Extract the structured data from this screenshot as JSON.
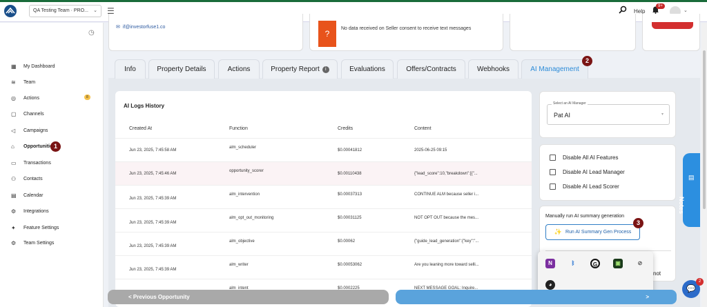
{
  "header": {
    "team_select": "QA Testing Team · PRO...",
    "help": "Help",
    "notifications_badge": "9+"
  },
  "sidebar": {
    "items": [
      {
        "label": "My Dashboard",
        "icon": "dashboard-icon"
      },
      {
        "label": "Team",
        "icon": "layers-icon"
      },
      {
        "label": "Actions",
        "icon": "check-circle-icon",
        "badge": "8"
      },
      {
        "label": "Channels",
        "icon": "chat-icon"
      },
      {
        "label": "Campaigns",
        "icon": "megaphone-icon"
      },
      {
        "label": "Opportunities",
        "icon": "home-icon"
      },
      {
        "label": "Transactions",
        "icon": "money-icon"
      },
      {
        "label": "Contacts",
        "icon": "people-icon"
      },
      {
        "label": "Calendar",
        "icon": "calendar-icon"
      },
      {
        "label": "Integrations",
        "icon": "plug-icon"
      },
      {
        "label": "Feature Settings",
        "icon": "feature-icon"
      },
      {
        "label": "Team Settings",
        "icon": "gear-icon"
      }
    ]
  },
  "markers": {
    "one": "1",
    "two": "2",
    "three": "3"
  },
  "top_cards": {
    "email": "if@investorfuse1.co",
    "consent_message": "No data received on Seller consent to receive text messages"
  },
  "tabs": [
    {
      "label": "Info"
    },
    {
      "label": "Property Details"
    },
    {
      "label": "Actions"
    },
    {
      "label": "Property Report"
    },
    {
      "label": "Evaluations"
    },
    {
      "label": "Offers/Contracts"
    },
    {
      "label": "Webhooks"
    },
    {
      "label": "AI Management"
    }
  ],
  "logs": {
    "title": "AI Logs History",
    "columns": [
      "Created At",
      "Function",
      "Credits",
      "Content"
    ],
    "rows": [
      {
        "created_at": "Jun 23, 2025, 7:45:58 AM",
        "function": "alm_scheduler",
        "credits": "$0.00041812",
        "content": "2025-06-25 09:15"
      },
      {
        "created_at": "Jun 23, 2025, 7:45:46 AM",
        "function": "opportunity_scorer",
        "credits": "$0.00110438",
        "content": "{\"lead_score\":10,\"breakdown\":[{\"..."
      },
      {
        "created_at": "Jun 23, 2025, 7:45:39 AM",
        "function": "alm_intervention",
        "credits": "$0.00037313",
        "content": "CONTINUE ALM because seller i..."
      },
      {
        "created_at": "Jun 23, 2025, 7:45:39 AM",
        "function": "alm_opt_out_monitoring",
        "credits": "$0.00031125",
        "content": "NOT OPT OUT because the mes..."
      },
      {
        "created_at": "Jun 23, 2025, 7:45:39 AM",
        "function": "alm_objective",
        "credits": "$0.00062",
        "content": "{\"guide_lead_generation\":{\"key\":\"..."
      },
      {
        "created_at": "Jun 23, 2025, 7:45:39 AM",
        "function": "alm_writer",
        "credits": "$0.00053062",
        "content": "Are you leaning more toward selli..."
      },
      {
        "created_at": "",
        "function": "alm_intent",
        "credits": "$0.0002225",
        "content": "NEXT MESSAGE GOAL: Inquire..."
      }
    ]
  },
  "ai_manager": {
    "legend": "Select an AI Manager",
    "value": "Pat AI"
  },
  "toggles": [
    {
      "label": "Disable All AI Features"
    },
    {
      "label": "Disable AI Lead Manager"
    },
    {
      "label": "Disable AI Lead Scorer"
    }
  ],
  "summary": {
    "label": "Manually run AI summary generation",
    "button": "Run AI Summary Gen Process"
  },
  "partial_text": "not",
  "notes_tab": "Notes",
  "bottom": {
    "prev": "Previous Opportunity",
    "next_arrow": ">",
    "prev_arrow": "<"
  },
  "chat_badge": "2"
}
